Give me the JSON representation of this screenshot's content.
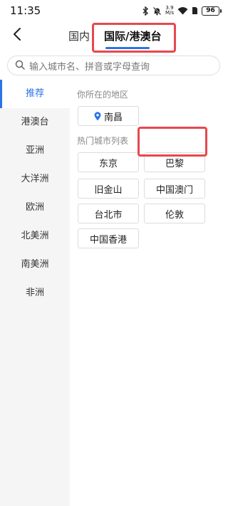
{
  "status_bar": {
    "time": "11:35",
    "net_speed_value": "3.9",
    "net_speed_unit": "M/s",
    "battery": "96",
    "icons": [
      "bluetooth-icon",
      "mute-bell-icon",
      "wifi-icon",
      "sim-icon",
      "battery-icon"
    ]
  },
  "header": {
    "tabs": [
      {
        "label": "国内",
        "active": false
      },
      {
        "label": "国际/港澳台",
        "active": true
      }
    ],
    "accent_color": "#2b74e6",
    "highlight_color": "#e8474f"
  },
  "search": {
    "placeholder": "输入城市名、拼音或字母查询"
  },
  "sidebar": {
    "items": [
      {
        "label": "推荐",
        "active": true
      },
      {
        "label": "港澳台",
        "active": false
      },
      {
        "label": "亚洲",
        "active": false
      },
      {
        "label": "大洋洲",
        "active": false
      },
      {
        "label": "欧洲",
        "active": false
      },
      {
        "label": "北美洲",
        "active": false
      },
      {
        "label": "南美洲",
        "active": false
      },
      {
        "label": "非洲",
        "active": false
      }
    ]
  },
  "content": {
    "location_section_label": "你所在的地区",
    "current_city": "南昌",
    "hot_section_label": "热门城市列表",
    "hot_cities": [
      "东京",
      "巴黎",
      "旧金山",
      "中国澳门",
      "台北市",
      "伦敦",
      "中国香港"
    ]
  }
}
